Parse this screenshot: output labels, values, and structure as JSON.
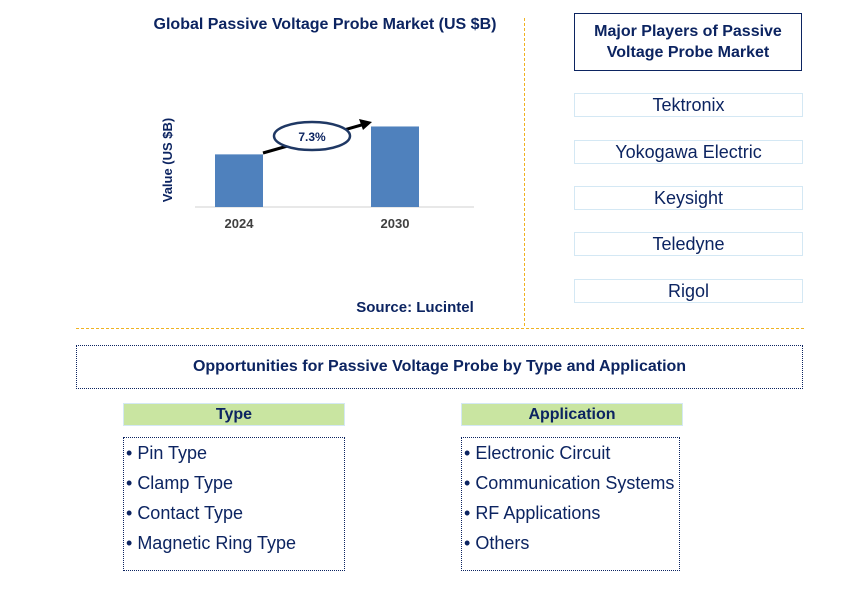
{
  "chart_data": {
    "type": "bar",
    "title": "Global Passive Voltage Probe Market (US $B)",
    "categories": [
      "2024",
      "2030"
    ],
    "values": [
      1.0,
      1.53
    ],
    "xlabel": "",
    "ylabel": "Value (US $B)",
    "ylim": [
      0,
      1.9
    ],
    "grid": false,
    "annotation": {
      "label": "7.3%",
      "meaning": "CAGR 2024-2030"
    },
    "bar_color": "#4f81bd"
  },
  "source": "Source: Lucintel",
  "players": {
    "title": "Major Players of Passive Voltage Probe Market",
    "items": [
      "Tektronix",
      "Yokogawa Electric",
      "Keysight",
      "Teledyne",
      "Rigol"
    ]
  },
  "opportunities": {
    "title": "Opportunities for Passive Voltage Probe by Type and Application",
    "segments": [
      {
        "label": "Type",
        "items": [
          "Pin Type",
          "Clamp Type",
          "Contact Type",
          "Magnetic Ring Type"
        ]
      },
      {
        "label": "Application",
        "items": [
          "Electronic Circuit",
          "Communication Systems",
          "RF Applications",
          "Others"
        ]
      }
    ]
  },
  "bullet": "•",
  "colors": {
    "navy": "#0c2461",
    "bar": "#4f81bd",
    "divider": "#f0b323",
    "segment_head": "#c9e5a1",
    "player_border": "#d4e8f4"
  }
}
